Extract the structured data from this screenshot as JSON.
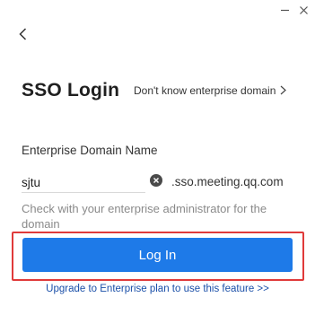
{
  "window": {
    "minimize_icon": "minimize-icon",
    "close_icon": "close-icon"
  },
  "nav": {
    "back_icon": "chevron-left-icon"
  },
  "header": {
    "title": "SSO Login",
    "enterprise_link": "Don't know enterprise domain",
    "enterprise_link_icon": "chevron-right-icon"
  },
  "form": {
    "domain_label": "Enterprise Domain Name",
    "domain_value": "sjtu",
    "clear_icon": "clear-circle-icon",
    "domain_suffix": ".sso.meeting.qq.com",
    "hint": "Check with your enterprise administrator for the domain",
    "login_label": "Log In"
  },
  "footer": {
    "upgrade_link": "Upgrade to Enterprise plan to use this feature >>"
  },
  "colors": {
    "accent": "#1e7ae8",
    "highlight": "#e03a3a",
    "link": "#1a4fa8"
  }
}
